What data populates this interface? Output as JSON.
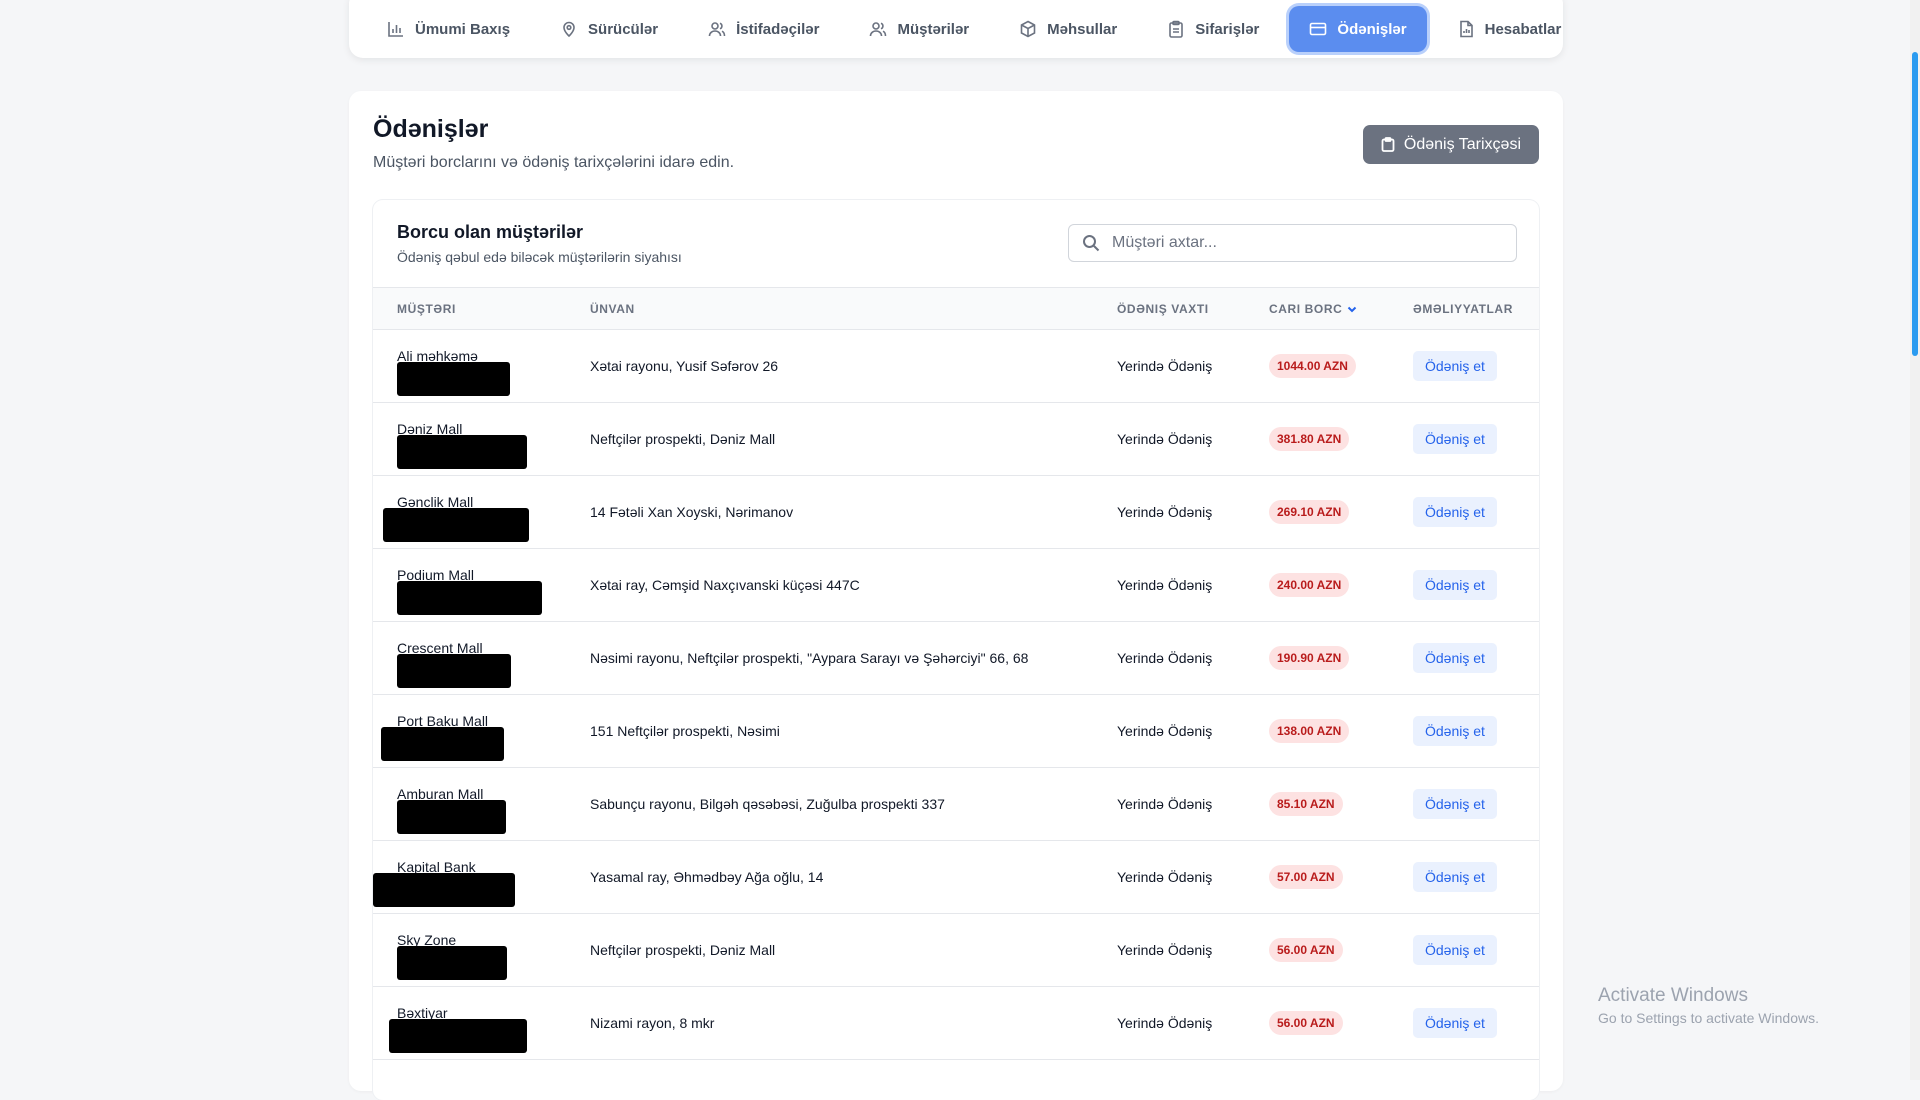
{
  "nav": {
    "items": [
      {
        "label": "Ümumi Baxış",
        "icon": "bar-chart-icon",
        "active": false
      },
      {
        "label": "Sürücülər",
        "icon": "map-pin-icon",
        "active": false
      },
      {
        "label": "İstifadəçilər",
        "icon": "users-icon",
        "active": false
      },
      {
        "label": "Müştərilər",
        "icon": "users-icon",
        "active": false
      },
      {
        "label": "Məhsullar",
        "icon": "box-icon",
        "active": false
      },
      {
        "label": "Sifarişlər",
        "icon": "clipboard-icon",
        "active": false
      },
      {
        "label": "Ödənişlər",
        "icon": "credit-card-icon",
        "active": true
      },
      {
        "label": "Hesabatlar",
        "icon": "file-chart-icon",
        "active": false
      }
    ]
  },
  "page": {
    "title": "Ödənişlər",
    "subtitle": "Müştəri borclarını və ödəniş tarixçələrini idarə edin.",
    "history_button": "Ödəniş Tarixçəsi"
  },
  "section": {
    "title": "Borcu olan müştərilər",
    "subtitle": "Ödəniş qəbul edə biləcək müştərilərin siyahısı",
    "search_placeholder": "Müştəri axtar...",
    "search_value": ""
  },
  "table": {
    "headers": {
      "customer": "MÜŞTƏRI",
      "address": "ÜNVAN",
      "payment_time": "ÖDƏNIŞ VAXTI",
      "current_debt": "CARI BORC",
      "actions": "ƏMƏLIYYATLAR"
    },
    "action_label": "Ödəniş et",
    "rows": [
      {
        "name": "Ali məhkəmə",
        "address": "Xətai rayonu, Yusif Səfərov 26",
        "time": "Yerində Ödəniş",
        "debt": "1044.00 AZN"
      },
      {
        "name": "Dəniz Mall",
        "address": "Neftçilər prospekti, Dəniz Mall",
        "time": "Yerində Ödəniş",
        "debt": "381.80 AZN"
      },
      {
        "name": "Gənclik Mall",
        "address": "14 Fətəli Xan Xoyski, Nərimanov",
        "time": "Yerində Ödəniş",
        "debt": "269.10 AZN"
      },
      {
        "name": "Podium Mall",
        "address": "Xətai ray, Cəmşid Naxçıvanski küçəsi 447C",
        "time": "Yerində Ödəniş",
        "debt": "240.00 AZN"
      },
      {
        "name": "Crescent Mall",
        "address": "Nəsimi rayonu, Neftçilər prospekti, \"Aypara Sarayı və Şəhərciyi\" 66, 68",
        "time": "Yerində Ödəniş",
        "debt": "190.90 AZN"
      },
      {
        "name": "Port Baku Mall",
        "address": "151 Neftçilər prospekti, Nəsimi",
        "time": "Yerində Ödəniş",
        "debt": "138.00 AZN"
      },
      {
        "name": "Amburan Mall",
        "address": "Sabunçu rayonu, Bilgəh qəsəbəsi, Zuğulba prospekti 337",
        "time": "Yerində Ödəniş",
        "debt": "85.10 AZN"
      },
      {
        "name": "Kapital Bank",
        "address": "Yasamal ray, Əhmədbəy Ağa oğlu, 14",
        "time": "Yerində Ödəniş",
        "debt": "57.00 AZN"
      },
      {
        "name": "Sky Zone",
        "address": "Neftçilər prospekti, Dəniz Mall",
        "time": "Yerində Ödəniş",
        "debt": "56.00 AZN"
      },
      {
        "name": "Bəxtiyar",
        "address": "Nizami rayon, 8 mkr",
        "time": "Yerində Ödəniş",
        "debt": "56.00 AZN"
      }
    ]
  },
  "watermark": {
    "title": "Activate Windows",
    "subtitle": "Go to Settings to activate Windows."
  },
  "colors": {
    "accent": "#5b8def",
    "debt_badge_bg": "#fde2e2",
    "debt_badge_text": "#b91c1c",
    "action_text": "#2563eb"
  }
}
